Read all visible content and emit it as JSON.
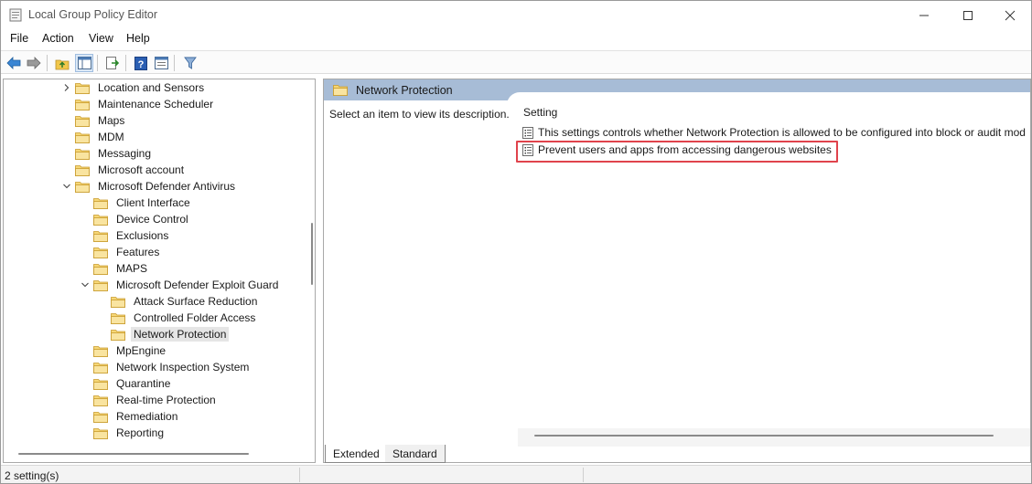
{
  "window": {
    "title": "Local Group Policy Editor",
    "controls": {
      "minimize": "minimize",
      "maximize": "maximize",
      "close": "close"
    }
  },
  "menu": [
    "File",
    "Action",
    "View",
    "Help"
  ],
  "toolbar": {
    "icons": [
      "back-arrow-icon",
      "forward-arrow-icon",
      "up-folder-icon",
      "show-hide-tree-icon",
      "export-list-icon",
      "help-icon",
      "properties-icon",
      "filter-icon"
    ]
  },
  "tree": {
    "items": [
      {
        "label": "Location and Sensors",
        "expander": "collapsed",
        "level": 0
      },
      {
        "label": "Maintenance Scheduler",
        "expander": "none",
        "level": 0
      },
      {
        "label": "Maps",
        "expander": "none",
        "level": 0
      },
      {
        "label": "MDM",
        "expander": "none",
        "level": 0
      },
      {
        "label": "Messaging",
        "expander": "none",
        "level": 0
      },
      {
        "label": "Microsoft account",
        "expander": "none",
        "level": 0
      },
      {
        "label": "Microsoft Defender Antivirus",
        "expander": "expanded",
        "level": 0
      },
      {
        "label": "Client Interface",
        "expander": "none",
        "level": 1
      },
      {
        "label": "Device Control",
        "expander": "none",
        "level": 1
      },
      {
        "label": "Exclusions",
        "expander": "none",
        "level": 1
      },
      {
        "label": "Features",
        "expander": "none",
        "level": 1
      },
      {
        "label": "MAPS",
        "expander": "none",
        "level": 1
      },
      {
        "label": "Microsoft Defender Exploit Guard",
        "expander": "expanded",
        "level": 1
      },
      {
        "label": "Attack Surface Reduction",
        "expander": "none",
        "level": 2
      },
      {
        "label": "Controlled Folder Access",
        "expander": "none",
        "level": 2
      },
      {
        "label": "Network Protection",
        "expander": "none",
        "level": 2,
        "selected": true
      },
      {
        "label": "MpEngine",
        "expander": "none",
        "level": 1
      },
      {
        "label": "Network Inspection System",
        "expander": "none",
        "level": 1
      },
      {
        "label": "Quarantine",
        "expander": "none",
        "level": 1
      },
      {
        "label": "Real-time Protection",
        "expander": "none",
        "level": 1
      },
      {
        "label": "Remediation",
        "expander": "none",
        "level": 1
      },
      {
        "label": "Reporting",
        "expander": "none",
        "level": 1
      }
    ]
  },
  "details": {
    "header": "Network Protection",
    "description": "Select an item to view its description.",
    "column_header": "Setting",
    "settings": [
      {
        "label": "This settings controls whether Network Protection is allowed to be configured into block or audit mod",
        "highlighted": false
      },
      {
        "label": "Prevent users and apps from accessing dangerous websites",
        "highlighted": true
      }
    ]
  },
  "tabs": [
    {
      "label": "Extended",
      "active": true
    },
    {
      "label": "Standard",
      "active": false
    }
  ],
  "status": {
    "text": "2 setting(s)"
  },
  "colors": {
    "header_bar": "#a7bcd6",
    "highlight": "#e0434c",
    "folder": "#f2c74b"
  }
}
